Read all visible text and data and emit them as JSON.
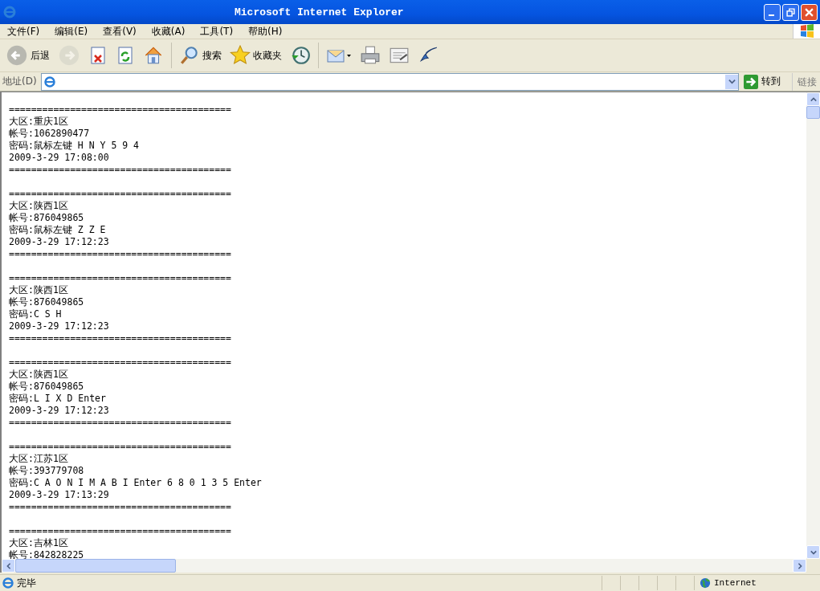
{
  "window": {
    "title": "Microsoft Internet Explorer"
  },
  "menu": [
    "文件(F)",
    "编辑(E)",
    "查看(V)",
    "收藏(A)",
    "工具(T)",
    "帮助(H)"
  ],
  "toolbar": [
    {
      "kind": "back",
      "label": "后退",
      "disabled": false
    },
    {
      "kind": "forward",
      "disabled": true
    },
    {
      "kind": "stop"
    },
    {
      "kind": "refresh"
    },
    {
      "kind": "home"
    },
    {
      "kind": "sep"
    },
    {
      "kind": "search",
      "label": "搜索"
    },
    {
      "kind": "favorites",
      "label": "收藏夹"
    },
    {
      "kind": "history"
    },
    {
      "kind": "sep"
    },
    {
      "kind": "mail"
    },
    {
      "kind": "print"
    },
    {
      "kind": "edit"
    },
    {
      "kind": "messenger"
    }
  ],
  "address_bar": {
    "label": "地址(D)",
    "go": "转到",
    "links": "链接"
  },
  "entries": [
    {
      "lines": [
        "========================================",
        "大区:重庆1区",
        "帐号:1062890477",
        "密码:鼠标左键 H N Y 5 9 4",
        "2009-3-29 17:08:00",
        "========================================"
      ]
    },
    {
      "lines": [
        "========================================",
        "大区:陕西1区",
        "帐号:876049865",
        "密码:鼠标左键 Z Z E",
        "2009-3-29 17:12:23",
        "========================================"
      ]
    },
    {
      "lines": [
        "========================================",
        "大区:陕西1区",
        "帐号:876049865",
        "密码:C S H",
        "2009-3-29 17:12:23",
        "========================================"
      ]
    },
    {
      "lines": [
        "========================================",
        "大区:陕西1区",
        "帐号:876049865",
        "密码:L I X D Enter",
        "2009-3-29 17:12:23",
        "========================================"
      ]
    },
    {
      "lines": [
        "========================================",
        "大区:江苏1区",
        "帐号:393779708",
        "密码:C A O N I M A B I Enter 6 8 0 1 3 5 Enter",
        "2009-3-29 17:13:29",
        "========================================"
      ]
    },
    {
      "lines": [
        "========================================",
        "大区:吉林1区",
        "帐号:842828225"
      ]
    }
  ],
  "status_bar": {
    "text": "完毕",
    "zone": "Internet"
  }
}
